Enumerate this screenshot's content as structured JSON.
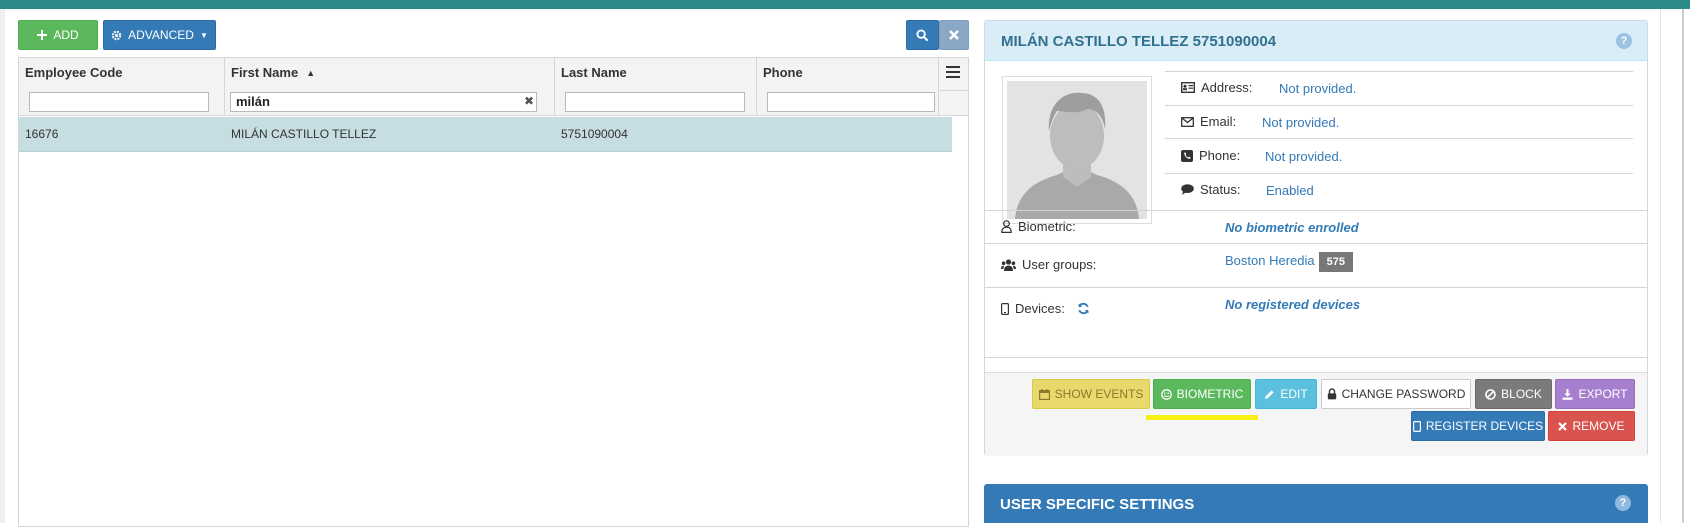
{
  "toolbar": {
    "add_label": "ADD",
    "advanced_label": "ADVANCED"
  },
  "grid": {
    "columns": [
      {
        "label": "Employee Code",
        "filter": ""
      },
      {
        "label": "First Name",
        "filter": "milán"
      },
      {
        "label": "Last Name",
        "filter": ""
      },
      {
        "label": "Phone",
        "filter": ""
      }
    ],
    "rows": [
      {
        "employee_code": "16676",
        "first_name": "MILÁN CASTILLO TELLEZ",
        "last_name": "5751090004",
        "phone": ""
      }
    ]
  },
  "detail": {
    "title": "MILÁN CASTILLO TELLEZ 5751090004",
    "address_label": "Address:",
    "address_value": "Not provided.",
    "email_label": "Email:",
    "email_value": "Not provided.",
    "phone_label": "Phone:",
    "phone_value": "Not provided.",
    "status_label": "Status:",
    "status_value": "Enabled",
    "biometric_label": "Biometric:",
    "biometric_value": "No biometric enrolled",
    "groups_label": "User groups:",
    "groups_value": "Boston Heredia",
    "groups_badge": "575",
    "devices_label": "Devices:",
    "devices_value": "No registered devices"
  },
  "actions": {
    "show_events": "SHOW EVENTS",
    "biometric": "BIOMETRIC",
    "edit": "EDIT",
    "change_password": "CHANGE PASSWORD",
    "block": "BLOCK",
    "export": "EXPORT",
    "register_devices": "REGISTER DEVICES",
    "remove": "REMOVE"
  },
  "settings": {
    "title": "USER SPECIFIC SETTINGS"
  },
  "colors": {
    "topbar": "#2c8a88",
    "selected_row": "#c6dde2",
    "panel_header": "#d9edf7",
    "primary": "#337ab7",
    "success": "#5cb85c",
    "highlight": "#f7f013"
  }
}
